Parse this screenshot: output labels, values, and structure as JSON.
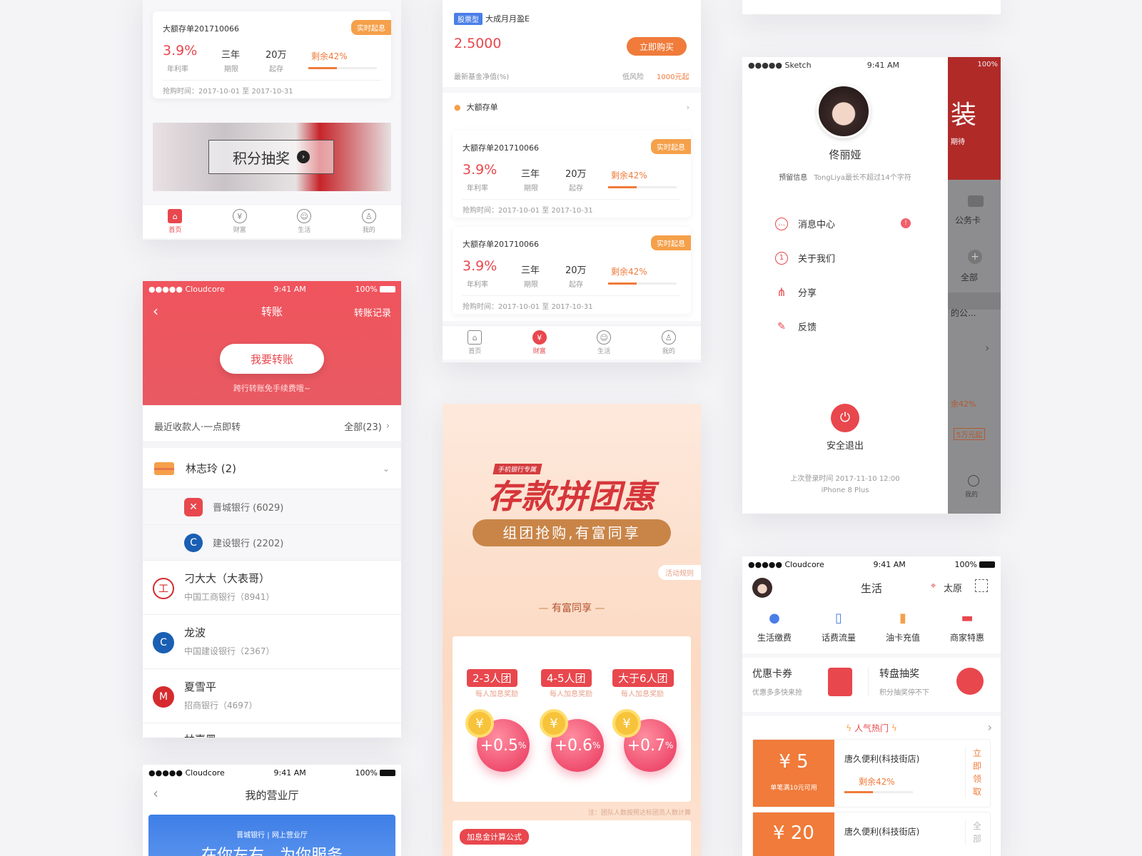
{
  "s1": {
    "card": {
      "title": "大额存单201710066",
      "tag": "实时起息",
      "rate": "3.9%",
      "rate_label": "年利率",
      "term": "三年",
      "term_label": "期限",
      "amount": "20万",
      "amount_label": "起存",
      "remain": "剩余42%",
      "remain_pct": 42,
      "time": "抢购时间：2017-10-01 至 2017-10-31"
    },
    "banner_text": "积分抽奖",
    "tabs": [
      "首页",
      "财富",
      "生活",
      "我的"
    ]
  },
  "s2": {
    "fund_tag": "股票型",
    "fund_name": "大成月月盈E",
    "nav": "2.5000",
    "nav_label": "最新基金净值(%)",
    "buy": "立即购买",
    "risk": "低风险",
    "min": "1000元起",
    "section": "大额存单",
    "cards": [
      {
        "title": "大额存单201710066",
        "tag": "实时起息",
        "rate": "3.9%",
        "rate_label": "年利率",
        "term": "三年",
        "term_label": "期限",
        "amount": "20万",
        "amount_label": "起存",
        "remain": "剩余42%",
        "remain_pct": 42,
        "time": "抢购时间：2017-10-01 至 2017-10-31"
      },
      {
        "title": "大额存单201710066",
        "tag": "实时起息",
        "rate": "3.9%",
        "rate_label": "年利率",
        "term": "三年",
        "term_label": "期限",
        "amount": "20万",
        "amount_label": "起存",
        "remain": "剩余42%",
        "remain_pct": 42,
        "time": "抢购时间：2017-10-01 至 2017-10-31"
      }
    ],
    "tabs": [
      "首页",
      "财富",
      "生活",
      "我的"
    ]
  },
  "s3": {
    "status": {
      "carrier": "●●●●● Sketch",
      "time": "9:41 AM",
      "battery": "100%"
    },
    "name": "佟丽娅",
    "info_label": "预留信息",
    "info": "TongLiya最长不超过14个字符",
    "menu": [
      "消息中心",
      "关于我们",
      "分享",
      "反馈"
    ],
    "logout": "安全退出",
    "last_login": "上次登录时间 2017-11-10 12:00",
    "device": "iPhone 8 Plus",
    "side": {
      "card": "公务卡",
      "all": "全部",
      "partial": "的公...",
      "remain": "余42%",
      "min": "5万元起",
      "mine": "我的",
      "banner": "装",
      "banner_sub": "期待"
    }
  },
  "s4": {
    "status": {
      "carrier": "●●●●● Cloudcore",
      "time": "9:41 AM",
      "battery": "100%"
    },
    "title": "转账",
    "record": "转账记录",
    "btn": "我要转账",
    "note": "跨行转账免手续费哦~",
    "recent": "最近收款人·一点即转",
    "all": "全部(23)",
    "group": "林志玲 (2)",
    "sub": [
      {
        "bank": "晋城银行 (6029)"
      },
      {
        "bank": "建设银行 (2202)"
      }
    ],
    "contacts": [
      {
        "name": "刁大大（大表哥）",
        "bank": "中国工商银行（8941）"
      },
      {
        "name": "龙波",
        "bank": "中国建设银行（2367）"
      },
      {
        "name": "夏雪平",
        "bank": "招商银行（4697）"
      },
      {
        "name": "林嘉冕",
        "bank": ""
      }
    ]
  },
  "s5": {
    "tag": "手机银行专属",
    "title": "存款拼团惠",
    "subtitle": "组团抢购,有富同享",
    "rules": "活动规则",
    "section": "有富同享",
    "groups": [
      {
        "label": "2-3人团",
        "sub": "每人加息奖励",
        "value": "+0.5",
        "unit": "%"
      },
      {
        "label": "4-5人团",
        "sub": "每人加息奖励",
        "value": "+0.6",
        "unit": "%"
      },
      {
        "label": "大于6人团",
        "sub": "每人加息奖励",
        "value": "+0.7",
        "unit": "%"
      }
    ],
    "coin": "¥",
    "note": "注：团队人数按照达标团员人数计算",
    "formula": "加息金计算公式"
  },
  "s6": {
    "status": {
      "carrier": "●●●●● Cloudcore",
      "time": "9:41 AM",
      "battery": "100%"
    },
    "title": "生活",
    "city": "太原",
    "services": [
      "生活缴费",
      "话费流量",
      "油卡充值",
      "商家特惠"
    ],
    "promo1": {
      "title": "优惠卡券",
      "sub": "优惠多多快来抢"
    },
    "promo2": {
      "title": "转盘抽奖",
      "sub": "积分抽奖停不下"
    },
    "hot": "人气热门",
    "coupons": [
      {
        "amount": "¥ 5",
        "cond": "单笔满10元可用",
        "shop": "唐久便利(科技街店)",
        "remain": "剩余42%",
        "remain_pct": 42,
        "action": "立即领取"
      },
      {
        "amount": "¥ 20",
        "cond": "",
        "shop": "唐久便利(科技街店)",
        "remain": "",
        "remain_pct": 0,
        "action": "全部"
      }
    ]
  },
  "s7": {
    "status": {
      "carrier": "●●●●● Cloudcore",
      "time": "9:41 AM",
      "battery": "100%"
    },
    "title": "我的营业厅",
    "banner_small": "晋城银行 | 网上营业厅",
    "banner_big": "在你左右，为你服务"
  }
}
